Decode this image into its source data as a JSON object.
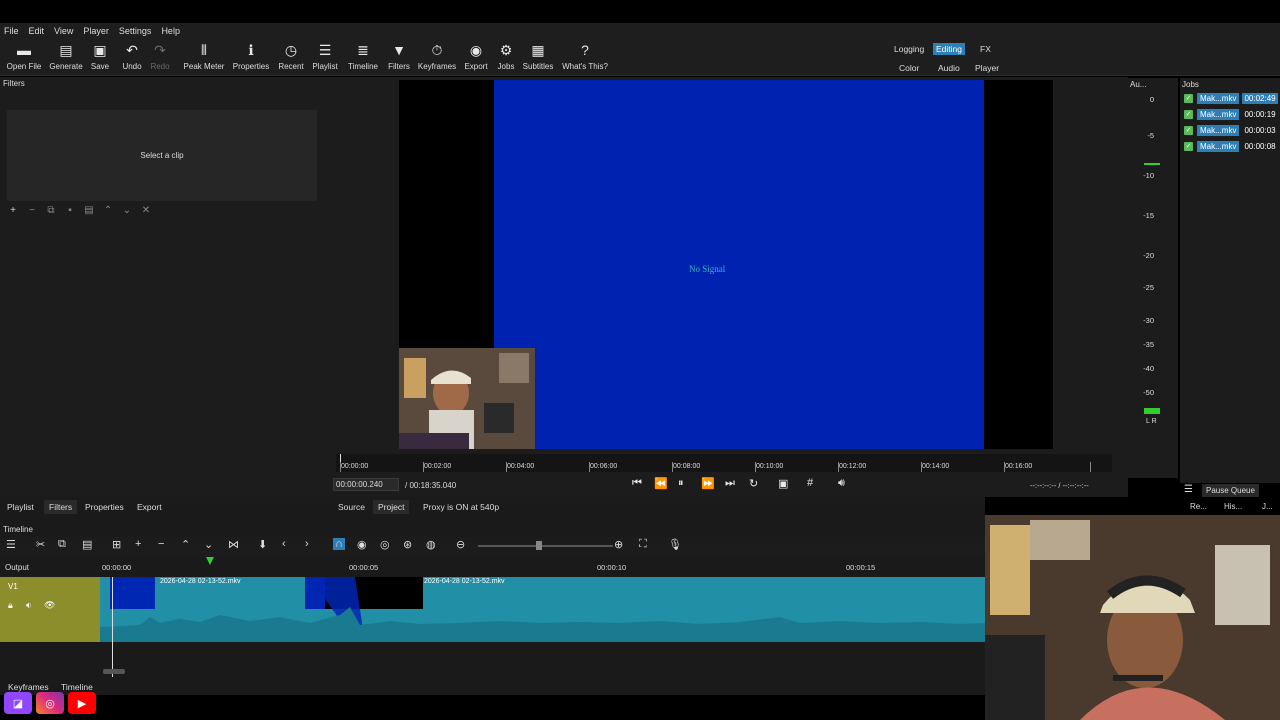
{
  "menu": [
    "File",
    "Edit",
    "View",
    "Player",
    "Settings",
    "Help"
  ],
  "toolbar": {
    "open_file": "Open File",
    "generate": "Generate",
    "save": "Save",
    "undo": "Undo",
    "redo": "Redo",
    "peak_meter": "Peak Meter",
    "properties": "Properties",
    "recent": "Recent",
    "playlist": "Playlist",
    "timeline": "Timeline",
    "filters": "Filters",
    "keyframes": "Keyframes",
    "export": "Export",
    "jobs": "Jobs",
    "subtitles": "Subtitles",
    "whats_this": "What's This?"
  },
  "workspaces": {
    "logging": "Logging",
    "editing": "Editing",
    "fx": "FX",
    "color": "Color",
    "audio": "Audio",
    "player": "Player"
  },
  "filters_panel": {
    "title": "Filters",
    "placeholder": "Select a clip"
  },
  "viewer": {
    "no_signal": "No Signal"
  },
  "meter": {
    "title": "Au...",
    "ticks": [
      "0",
      "-5",
      "-10",
      "-15",
      "-20",
      "-25",
      "-30",
      "-35",
      "-40",
      "-50"
    ],
    "channels": "L R"
  },
  "jobs": {
    "title": "Jobs",
    "items": [
      {
        "name": "Mak...mkv",
        "time": "00:02:49"
      },
      {
        "name": "Mak...mkv",
        "time": "00:00:19"
      },
      {
        "name": "Mak...mkv",
        "time": "00:00:03"
      },
      {
        "name": "Mak...mkv",
        "time": "00:00:08"
      }
    ],
    "pause_queue": "Pause Queue",
    "tab1": "Re...",
    "tab2": "His...",
    "tab3": "J..."
  },
  "ruler_ticks": [
    "00:00:00",
    "00:02:00",
    "00:04:00",
    "00:06:00",
    "00:08:00",
    "00:10:00",
    "00:12:00",
    "00:14:00",
    "00:16:00"
  ],
  "transport": {
    "position": "00:00:00.240",
    "duration": "/  00:18:35.040",
    "in_out": "--:--:--:-- / --:--:--:--"
  },
  "left_tabs": {
    "playlist": "Playlist",
    "filters": "Filters",
    "properties": "Properties",
    "export": "Export"
  },
  "viewer_tabs": {
    "source": "Source",
    "project": "Project",
    "proxy": "Proxy is ON at 540p"
  },
  "timeline": {
    "title": "Timeline",
    "output": "Output",
    "track": "V1",
    "ticks": [
      "00:00:00",
      "00:00:05",
      "00:00:10",
      "00:00:15"
    ],
    "clip1": "2026-04-28 02-13-52.mkv",
    "clip2": "2026-04-28 02-13-52.mkv"
  },
  "bottom_tabs": {
    "keyframes": "Keyframes",
    "timeline": "Timeline"
  },
  "colors": {
    "accent": "#2d7fb8",
    "track_head": "#8b8e2a",
    "track": "#218fa6",
    "viewer_blue": "#0022b0"
  }
}
